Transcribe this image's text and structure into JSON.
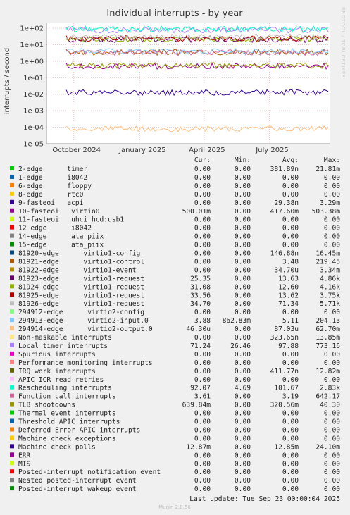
{
  "chart_data": {
    "type": "line",
    "title": "Individual interrupts - by year",
    "ylabel": "interrupts / second",
    "side_label": "RRDTOOL / TOBI OETIKER",
    "yscale": "log",
    "ylim": [
      1e-05,
      200
    ],
    "yticks": [
      {
        "value": 100,
        "label": "1e+02"
      },
      {
        "value": 10,
        "label": "1e+01"
      },
      {
        "value": 1,
        "label": "1e+00"
      },
      {
        "value": 0.1,
        "label": "1e-01"
      },
      {
        "value": 0.01,
        "label": "1e-02"
      },
      {
        "value": 0.001,
        "label": "1e-03"
      },
      {
        "value": 0.0001,
        "label": "1e-04"
      },
      {
        "value": 1e-05,
        "label": "1e-05"
      }
    ],
    "xlim": [
      "2024-08-24",
      "2025-09-23"
    ],
    "xticks": [
      {
        "value": "2024-10-01",
        "label": "October 2024"
      },
      {
        "value": "2025-01-01",
        "label": "January 2025"
      },
      {
        "value": "2025-04-01",
        "label": "April 2025"
      },
      {
        "value": "2025-07-01",
        "label": "July 2025"
      }
    ],
    "grid": true,
    "legend_header": [
      "Cur:",
      "Min:",
      "Avg:",
      "Max:"
    ],
    "series": [
      {
        "name": "2-edge      timer",
        "color": "#00cc00",
        "cur": "0.00",
        "min": "0.00",
        "avg": "381.89n",
        "max": "21.81m"
      },
      {
        "name": "1-edge      i8042",
        "color": "#0066b3",
        "cur": "0.00",
        "min": "0.00",
        "avg": "0.00",
        "max": "0.00"
      },
      {
        "name": "6-edge      floppy",
        "color": "#ff8000",
        "cur": "0.00",
        "min": "0.00",
        "avg": "0.00",
        "max": "0.00"
      },
      {
        "name": "8-edge      rtc0",
        "color": "#ffcc00",
        "cur": "0.00",
        "min": "0.00",
        "avg": "0.00",
        "max": "0.00"
      },
      {
        "name": "9-fasteoi   acpi",
        "color": "#330099",
        "cur": "0.00",
        "min": "0.00",
        "avg": "29.38n",
        "max": "3.29m"
      },
      {
        "name": "10-fasteoi   virtio0",
        "color": "#990099",
        "cur": "500.01m",
        "min": "0.00",
        "avg": "417.60m",
        "max": "503.38m",
        "level": 0.5
      },
      {
        "name": "11-fasteoi   uhci_hcd:usb1",
        "color": "#ccff00",
        "cur": "0.00",
        "min": "0.00",
        "avg": "0.00",
        "max": "0.00"
      },
      {
        "name": "12-edge      i8042",
        "color": "#ff0000",
        "cur": "0.00",
        "min": "0.00",
        "avg": "0.00",
        "max": "0.00"
      },
      {
        "name": "14-edge      ata_piix",
        "color": "#808080",
        "cur": "0.00",
        "min": "0.00",
        "avg": "0.00",
        "max": "0.00"
      },
      {
        "name": "15-edge      ata_piix",
        "color": "#008f00",
        "cur": "0.00",
        "min": "0.00",
        "avg": "0.00",
        "max": "0.00"
      },
      {
        "name": "81920-edge      virtio1-config",
        "color": "#00487d",
        "cur": "0.00",
        "min": "0.00",
        "avg": "146.88n",
        "max": "16.45m"
      },
      {
        "name": "81921-edge      virtio1-control",
        "color": "#b35a00",
        "cur": "0.00",
        "min": "0.00",
        "avg": "3.48",
        "max": "219.45",
        "level": 3.5
      },
      {
        "name": "81922-edge      virtio1-event",
        "color": "#b38f00",
        "cur": "0.00",
        "min": "0.00",
        "avg": "34.70u",
        "max": "3.34m"
      },
      {
        "name": "81923-edge      virtio1-request",
        "color": "#6b006b",
        "cur": "25.35",
        "min": "0.00",
        "avg": "13.63",
        "max": "4.86k",
        "level": 20
      },
      {
        "name": "81924-edge      virtio1-request",
        "color": "#8fb300",
        "cur": "31.08",
        "min": "0.00",
        "avg": "12.60",
        "max": "4.16k",
        "level": 22
      },
      {
        "name": "81925-edge      virtio1-request",
        "color": "#b30000",
        "cur": "33.56",
        "min": "0.00",
        "avg": "13.62",
        "max": "3.75k",
        "level": 24
      },
      {
        "name": "81926-edge      virtio1-request",
        "color": "#bebebe",
        "cur": "34.70",
        "min": "0.00",
        "avg": "71.34",
        "max": "5.71k",
        "level": 30
      },
      {
        "name": "294912-edge      virtio2-config",
        "color": "#80ff80",
        "cur": "0.00",
        "min": "0.00",
        "avg": "0.00",
        "max": "0.00"
      },
      {
        "name": "294913-edge      virtio2-input.0",
        "color": "#80c9ff",
        "cur": "3.88",
        "min": "862.83m",
        "avg": "5.11",
        "max": "204.13",
        "level": 4
      },
      {
        "name": "294914-edge      virtio2-output.0",
        "color": "#ffc080",
        "cur": "46.30u",
        "min": "0.00",
        "avg": "87.03u",
        "max": "62.70m",
        "level": 8e-05
      },
      {
        "name": "Non-maskable interrupts",
        "color": "#ffe680",
        "cur": "0.00",
        "min": "0.00",
        "avg": "323.65n",
        "max": "13.85m"
      },
      {
        "name": "Local timer interrupts",
        "color": "#aa80ff",
        "cur": "71.24",
        "min": "26.46",
        "avg": "97.88",
        "max": "773.16",
        "level": 75
      },
      {
        "name": "Spurious interrupts",
        "color": "#ee00cc",
        "cur": "0.00",
        "min": "0.00",
        "avg": "0.00",
        "max": "0.00"
      },
      {
        "name": "Performance monitoring interrupts",
        "color": "#ff8080",
        "cur": "0.00",
        "min": "0.00",
        "avg": "0.00",
        "max": "0.00"
      },
      {
        "name": "IRQ work interrupts",
        "color": "#666600",
        "cur": "0.00",
        "min": "0.00",
        "avg": "411.77n",
        "max": "12.82m"
      },
      {
        "name": "APIC ICR read retries",
        "color": "#ffbfff",
        "cur": "0.00",
        "min": "0.00",
        "avg": "0.00",
        "max": "0.00"
      },
      {
        "name": "Rescheduling interrupts",
        "color": "#00ffcc",
        "cur": "92.07",
        "min": "4.69",
        "avg": "101.67",
        "max": "2.83k",
        "level": 90
      },
      {
        "name": "Function call interrupts",
        "color": "#cc6699",
        "cur": "3.61",
        "min": "0.00",
        "avg": "3.19",
        "max": "642.17",
        "level": 3.3
      },
      {
        "name": "TLB shootdowns",
        "color": "#999900",
        "cur": "639.84m",
        "min": "0.00",
        "avg": "320.56m",
        "max": "40.30",
        "level": 0.55
      },
      {
        "name": "Thermal event interrupts",
        "color": "#00cc00",
        "cur": "0.00",
        "min": "0.00",
        "avg": "0.00",
        "max": "0.00"
      },
      {
        "name": "Threshold APIC interrupts",
        "color": "#0066b3",
        "cur": "0.00",
        "min": "0.00",
        "avg": "0.00",
        "max": "0.00"
      },
      {
        "name": "Deferred Error APIC interrupts",
        "color": "#ff8000",
        "cur": "0.00",
        "min": "0.00",
        "avg": "0.00",
        "max": "0.00"
      },
      {
        "name": "Machine check exceptions",
        "color": "#ffcc00",
        "cur": "0.00",
        "min": "0.00",
        "avg": "0.00",
        "max": "0.00"
      },
      {
        "name": "Machine check polls",
        "color": "#330099",
        "cur": "12.87m",
        "min": "0.00",
        "avg": "12.85m",
        "max": "24.10m",
        "level": 0.0129
      },
      {
        "name": "ERR",
        "color": "#990099",
        "cur": "0.00",
        "min": "0.00",
        "avg": "0.00",
        "max": "0.00"
      },
      {
        "name": "MIS",
        "color": "#ccff00",
        "cur": "0.00",
        "min": "0.00",
        "avg": "0.00",
        "max": "0.00"
      },
      {
        "name": "Posted-interrupt notification event",
        "color": "#ff0000",
        "cur": "0.00",
        "min": "0.00",
        "avg": "0.00",
        "max": "0.00"
      },
      {
        "name": "Nested posted-interrupt event",
        "color": "#808080",
        "cur": "0.00",
        "min": "0.00",
        "avg": "0.00",
        "max": "0.00"
      },
      {
        "name": "Posted-interrupt wakeup event",
        "color": "#008f00",
        "cur": "0.00",
        "min": "0.00",
        "avg": "0.00",
        "max": "0.00"
      }
    ],
    "last_update": "Last update: Tue Sep 23 00:00:04 2025",
    "footer": "Munin 2.0.56"
  }
}
